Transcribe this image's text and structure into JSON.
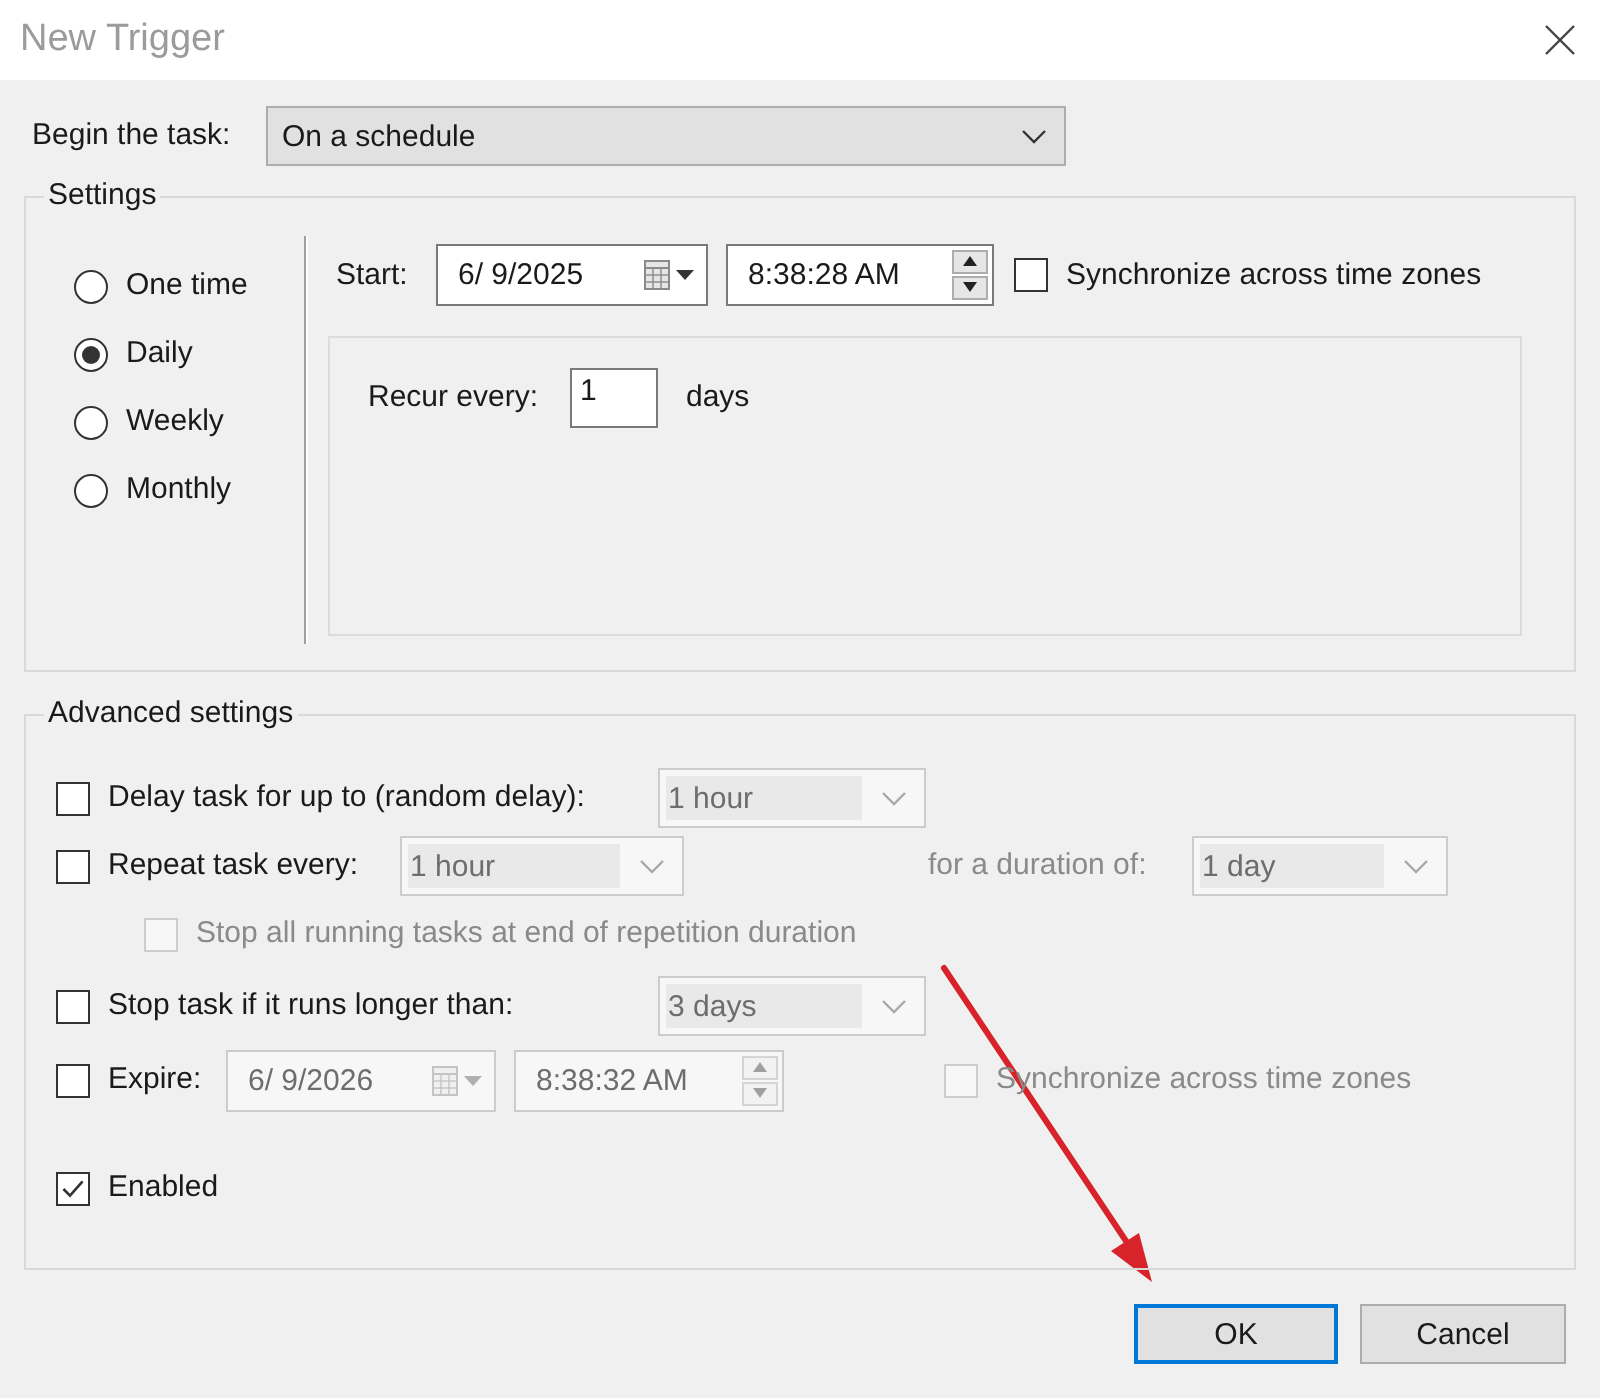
{
  "window": {
    "title": "New Trigger"
  },
  "begin_task": {
    "label": "Begin the task:",
    "value": "On a schedule"
  },
  "settings": {
    "legend": "Settings",
    "schedule_options": [
      {
        "label": "One time",
        "selected": false
      },
      {
        "label": "Daily",
        "selected": true
      },
      {
        "label": "Weekly",
        "selected": false
      },
      {
        "label": "Monthly",
        "selected": false
      }
    ],
    "start": {
      "label": "Start:",
      "date": "6/ 9/2025",
      "time": "8:38:28 AM",
      "sync": {
        "label": "Synchronize across time zones",
        "checked": false
      }
    },
    "recur": {
      "label": "Recur every:",
      "value": "1",
      "unit": "days"
    }
  },
  "advanced_settings": {
    "legend": "Advanced settings",
    "delay": {
      "label": "Delay task for up to (random delay):",
      "checked": false,
      "dropdown": {
        "value": "1 hour",
        "disabled": true
      }
    },
    "repeat": {
      "label": "Repeat task every:",
      "checked": false,
      "dropdown": {
        "value": "1 hour",
        "disabled": true
      },
      "duration": {
        "label": "for a duration of:",
        "value": "1 day",
        "disabled": true
      }
    },
    "stop_all_running": {
      "label": "Stop all running tasks at end of repetition duration",
      "checked": false,
      "disabled": true
    },
    "stop_if_longer": {
      "label": "Stop task if it runs longer than:",
      "checked": false,
      "dropdown": {
        "value": "3 days",
        "disabled": true
      }
    },
    "expire": {
      "label": "Expire:",
      "checked": false,
      "date": "6/ 9/2026",
      "time": "8:38:32 AM",
      "disabled": true,
      "sync": {
        "label": "Synchronize across time zones",
        "checked": false,
        "disabled": true
      }
    },
    "enabled": {
      "label": "Enabled",
      "checked": true
    }
  },
  "buttons": [
    {
      "label": "OK",
      "default": true
    },
    {
      "label": "Cancel",
      "default": false
    }
  ],
  "annotations": [
    {
      "kind": "arrow"
    }
  ]
}
